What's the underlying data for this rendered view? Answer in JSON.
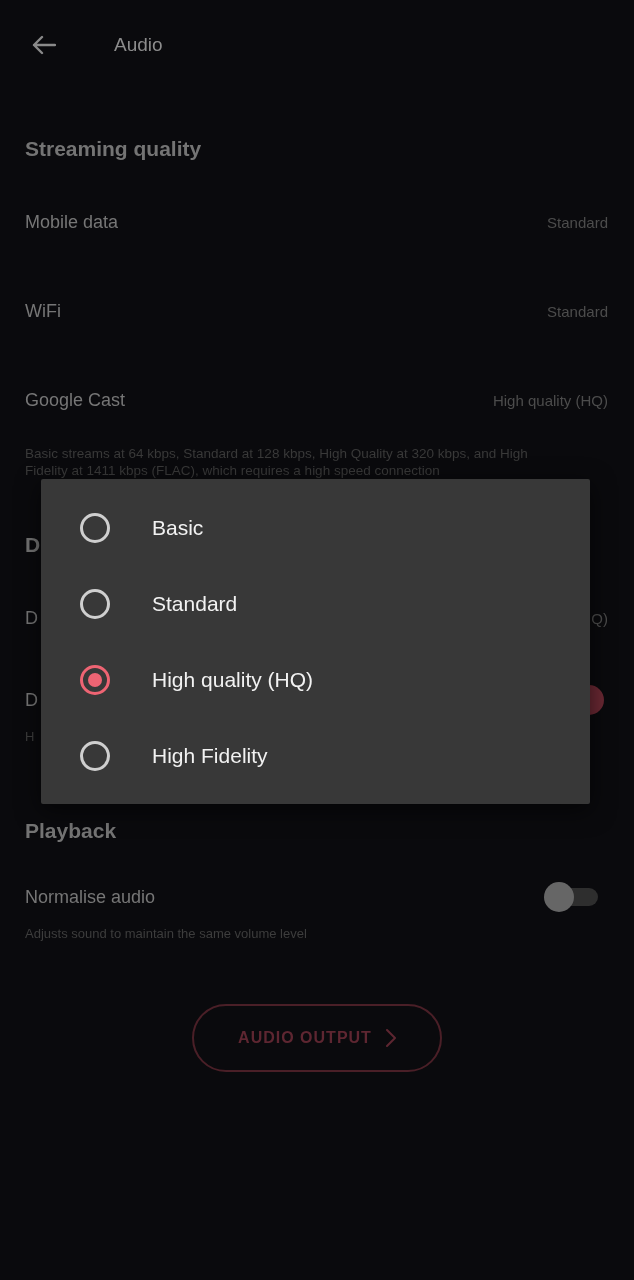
{
  "header": {
    "title": "Audio"
  },
  "sections": [
    {
      "title": "Streaming quality",
      "rows": [
        {
          "kind": "value",
          "label": "Mobile data",
          "value": "Standard"
        },
        {
          "kind": "value",
          "label": "WiFi",
          "value": "Standard"
        },
        {
          "kind": "value",
          "label": "Google Cast",
          "value": "High quality (HQ)"
        }
      ],
      "note": "Basic streams at 64 kbps, Standard at 128 kbps, High Quality at 320 kbps, and High Fidelity at 1411 kbps (FLAC), which requires a high speed connection"
    },
    {
      "title": "D",
      "rows": [
        {
          "kind": "value",
          "label": "D",
          "value": "Q)"
        },
        {
          "kind": "toggle",
          "label": "D",
          "on": true,
          "description": "H"
        }
      ]
    },
    {
      "title": "Playback",
      "rows": [
        {
          "kind": "toggle",
          "label": "Normalise audio",
          "on": false,
          "description": "Adjusts sound to maintain the same volume level"
        }
      ]
    }
  ],
  "audio_output_button": {
    "label": "AUDIO OUTPUT"
  },
  "dialog": {
    "options": [
      {
        "label": "Basic",
        "selected": false
      },
      {
        "label": "Standard",
        "selected": false
      },
      {
        "label": "High quality (HQ)",
        "selected": true
      },
      {
        "label": "High Fidelity",
        "selected": false
      }
    ]
  }
}
